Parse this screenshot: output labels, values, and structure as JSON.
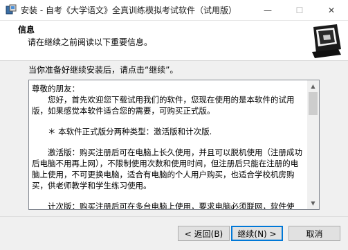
{
  "window": {
    "title": "安装 - 自考《大学语文》全真训练模拟考试软件（试用版）",
    "minimize_glyph": "—",
    "maximize_glyph": "☐",
    "close_glyph": "✕"
  },
  "header": {
    "title": "信息",
    "subtitle": "请在继续之前阅读以下重要信息。"
  },
  "instruction": "当你准备好继续安装后，请点击“继续”。",
  "info_text": {
    "greeting": "尊敬的朋友：",
    "para1": "您好，首先欢迎您下载试用我们的软件，您现在使用的是本软件的试用版，如果感觉本软件适合您的需要，可购买正式版。",
    "para2": "＊ 本软件正式版分两种类型：激活版和计次版.",
    "para3": "激活版：购买注册后可在电脑上长久使用，并且可以脱机使用（注册成功后电脑不用再上网），不限制使用次数和使用时间，但注册后只能在注册的电脑上使用，不可更换电脑，适合有电脑的个人用户购买，也适合学校机房购买，供老师教学和学生练习使用。",
    "para4": "计次版：购买注册后可在多台电脑上使用，要求电脑必须联网，软件使"
  },
  "buttons": {
    "back": "< 返回(B)",
    "next": "继续(N) >",
    "cancel": "取消"
  },
  "icons": {
    "app": "installer-app-icon",
    "header": "computer-box-icon"
  },
  "colors": {
    "focus_border": "#0078d7",
    "background": "#f0f0f0"
  }
}
